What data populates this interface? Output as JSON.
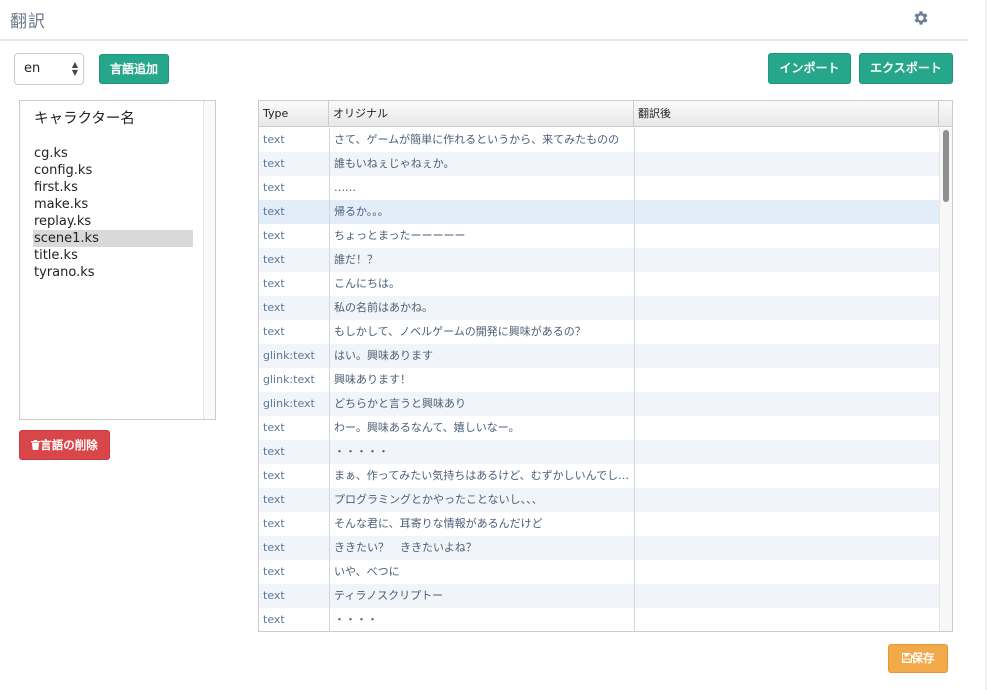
{
  "header": {
    "title": "翻訳",
    "settings_icon": "gear-icon"
  },
  "controls": {
    "language_select": {
      "value": "en",
      "icon": "updown-arrows-icon"
    },
    "add_language_label": "言語追加",
    "import_label": "インポート",
    "export_label": "エクスポート",
    "delete_language_label": "言語の削除",
    "delete_icon": "trash-icon",
    "save_label": "保存",
    "save_icon": "floppy-disk-icon"
  },
  "file_list": {
    "title": "キャラクター名",
    "items": [
      {
        "label": "cg.ks",
        "selected": false
      },
      {
        "label": "config.ks",
        "selected": false
      },
      {
        "label": "first.ks",
        "selected": false
      },
      {
        "label": "make.ks",
        "selected": false
      },
      {
        "label": "replay.ks",
        "selected": false
      },
      {
        "label": "scene1.ks",
        "selected": true
      },
      {
        "label": "title.ks",
        "selected": false
      },
      {
        "label": "tyrano.ks",
        "selected": false
      }
    ]
  },
  "grid": {
    "columns": [
      "Type",
      "オリジナル",
      "翻訳後"
    ],
    "rows": [
      {
        "type": "text",
        "original": "さて、ゲームが簡単に作れるというから、来てみたものの",
        "translated": ""
      },
      {
        "type": "text",
        "original": "誰もいねぇじゃねぇか。",
        "translated": ""
      },
      {
        "type": "text",
        "original": "……",
        "translated": ""
      },
      {
        "type": "text",
        "original": "帰るか。。。",
        "translated": "",
        "highlighted": true
      },
      {
        "type": "text",
        "original": "ちょっとまったーーーーー",
        "translated": ""
      },
      {
        "type": "text",
        "original": "誰だ！？",
        "translated": ""
      },
      {
        "type": "text",
        "original": "こんにちは。",
        "translated": ""
      },
      {
        "type": "text",
        "original": "私の名前はあかね。",
        "translated": ""
      },
      {
        "type": "text",
        "original": "もしかして、ノベルゲームの開発に興味があるの？",
        "translated": ""
      },
      {
        "type": "glink:text",
        "original": "はい。興味あります",
        "translated": ""
      },
      {
        "type": "glink:text",
        "original": "興味あります！",
        "translated": ""
      },
      {
        "type": "glink:text",
        "original": "どちらかと言うと興味あり",
        "translated": ""
      },
      {
        "type": "text",
        "original": "わー。興味あるなんて、嬉しいなー。",
        "translated": ""
      },
      {
        "type": "text",
        "original": "・・・・・",
        "translated": ""
      },
      {
        "type": "text",
        "original": "まぁ、作ってみたい気持ちはあるけど、むずかしいんでし…",
        "translated": ""
      },
      {
        "type": "text",
        "original": "プログラミングとかやったことないし、、、",
        "translated": ""
      },
      {
        "type": "text",
        "original": "そんな君に、耳寄りな情報があるんだけど",
        "translated": ""
      },
      {
        "type": "text",
        "original": "ききたい？　ききたいよね？",
        "translated": ""
      },
      {
        "type": "text",
        "original": "いや、べつに",
        "translated": ""
      },
      {
        "type": "text",
        "original": "ティラノスクリプトー",
        "translated": ""
      },
      {
        "type": "text",
        "original": "・・・・",
        "translated": ""
      }
    ]
  }
}
